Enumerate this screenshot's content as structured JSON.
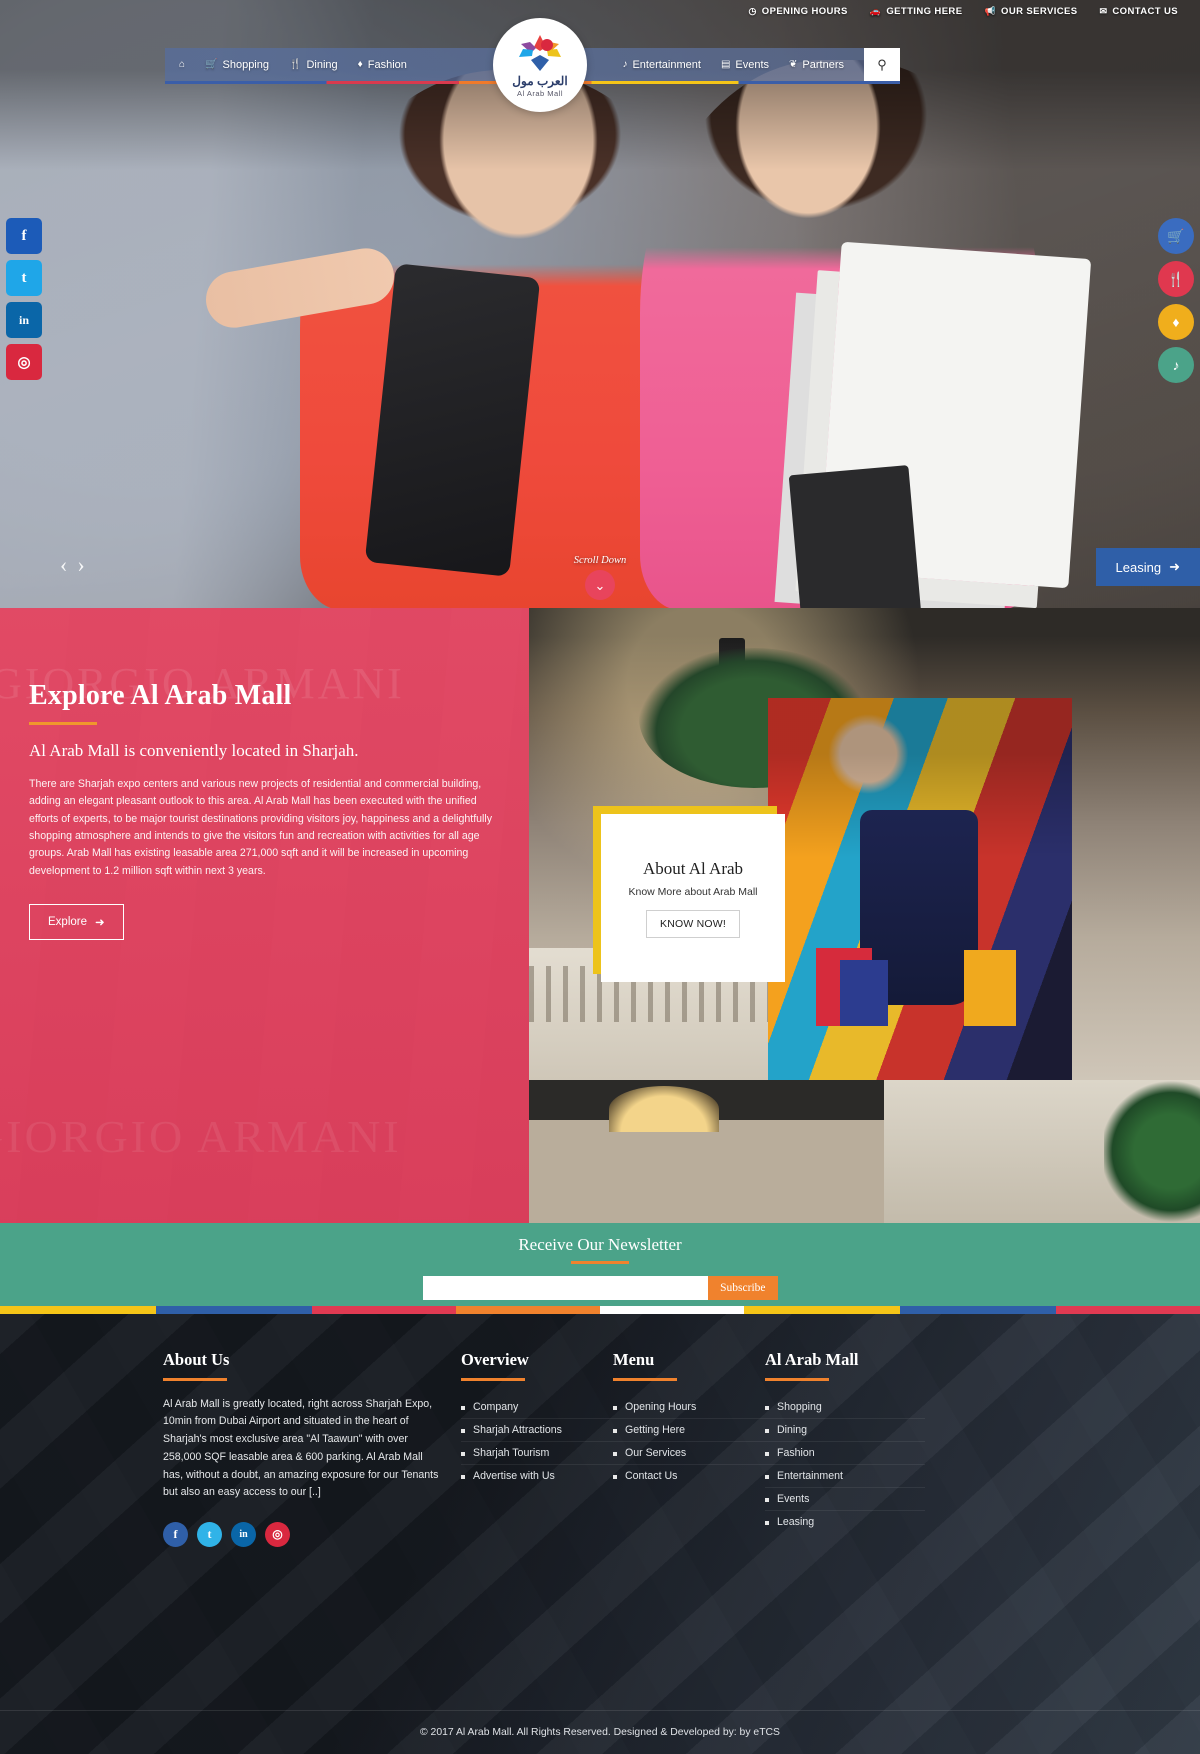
{
  "topbar": {
    "links": [
      {
        "icon": "clock-icon",
        "glyph": "◷",
        "label": "OPENING HOURS"
      },
      {
        "icon": "car-icon",
        "glyph": "⛟",
        "label": "GETTING HERE"
      },
      {
        "icon": "megaphone-icon",
        "glyph": "📣",
        "label": "OUR SERVICES"
      },
      {
        "icon": "envelope-icon",
        "glyph": "✉",
        "label": "CONTACT US"
      }
    ]
  },
  "nav": {
    "left": [
      {
        "icon": "home-icon",
        "glyph": "⌂",
        "label": ""
      },
      {
        "icon": "cart-icon",
        "glyph": "🛒",
        "label": "Shopping"
      },
      {
        "icon": "utensils-icon",
        "glyph": "🍴",
        "label": "Dining"
      },
      {
        "icon": "diamond-icon",
        "glyph": "♦",
        "label": "Fashion"
      }
    ],
    "right": [
      {
        "icon": "music-note-icon",
        "glyph": "♪",
        "label": "Entertainment"
      },
      {
        "icon": "list-icon",
        "glyph": "▤",
        "label": "Events"
      },
      {
        "icon": "handshake-icon",
        "glyph": "❦",
        "label": "Partners"
      }
    ],
    "search_icon": "search-icon",
    "search_glyph": "⌕"
  },
  "logo": {
    "arabic": "العرب مول",
    "english": "Al Arab Mall"
  },
  "hero": {
    "social_left": [
      {
        "name": "facebook",
        "glyph": "f",
        "color": "#1c5bb8"
      },
      {
        "name": "twitter",
        "glyph": "t",
        "color": "#1fa6e8"
      },
      {
        "name": "linkedin",
        "glyph": "in",
        "color": "#0a66a8"
      },
      {
        "name": "instagram",
        "glyph": "◎",
        "color": "#d9283f"
      }
    ],
    "quick_right": [
      {
        "name": "shopping",
        "glyph": "🛒",
        "color": "#3a6cc0"
      },
      {
        "name": "dining",
        "glyph": "🍴",
        "color": "#e0384f"
      },
      {
        "name": "fashion",
        "glyph": "♦",
        "color": "#f0ae1c"
      },
      {
        "name": "entertainment",
        "glyph": "♪",
        "color": "#4ba389"
      }
    ],
    "prev_glyph": "‹",
    "next_glyph": "›",
    "scroll_label": "Scroll Down",
    "scroll_glyph": "⌄⌄",
    "leasing_label": "Leasing",
    "leasing_arrow": "➜"
  },
  "explore": {
    "heading": "Explore Al Arab Mall",
    "subheading": "Al Arab Mall is conveniently located in Sharjah.",
    "paragraph": "There are Sharjah expo centers and various new projects of residential and commercial building, adding an elegant pleasant outlook to this area. Al Arab Mall has been executed with the unified efforts of experts, to be major tourist destinations providing visitors joy, happiness and a delightfully shopping atmosphere and intends to give the visitors fun and recreation with activities for all age groups. Arab Mall has existing leasable area 271,000 sqft and it will be increased in upcoming development to 1.2 million sqft within next 3 years.",
    "button_label": "Explore",
    "button_arrow": "➜"
  },
  "about_card": {
    "title": "About Al Arab",
    "subtitle": "Know More about Arab Mall",
    "button_label": "KNOW NOW!"
  },
  "newsletter": {
    "heading": "Receive Our Newsletter",
    "input_placeholder": "",
    "input_value": "",
    "button_label": "Subscribe"
  },
  "footer": {
    "about": {
      "heading": "About Us",
      "text": "Al Arab Mall is greatly located, right across Sharjah Expo, 10min from Dubai Airport and situated in the heart of Sharjah's most exclusive area \"Al Taawun\" with over 258,000 SQF leasable area & 600 parking. Al Arab Mall has, without a doubt, an amazing exposure for our Tenants but also an easy access to our [..]"
    },
    "social": [
      {
        "name": "facebook",
        "glyph": "f",
        "color": "#2f5fa8"
      },
      {
        "name": "twitter",
        "glyph": "t",
        "color": "#30b3e8"
      },
      {
        "name": "linkedin",
        "glyph": "in",
        "color": "#0a66a8"
      },
      {
        "name": "instagram",
        "glyph": "◎",
        "color": "#d9283f"
      }
    ],
    "overview": {
      "heading": "Overview",
      "items": [
        "Company",
        "Sharjah Attractions",
        "Sharjah Tourism",
        "Advertise with Us"
      ]
    },
    "menu": {
      "heading": "Menu",
      "items": [
        "Opening Hours",
        "Getting Here",
        "Our Services",
        "Contact Us"
      ]
    },
    "mall": {
      "heading": "Al Arab Mall",
      "items": [
        "Shopping",
        "Dining",
        "Fashion",
        "Entertainment",
        "Events",
        "Leasing"
      ]
    },
    "copyright": "© 2017 Al Arab Mall. All Rights Reserved. Designed & Developed by: by eTCS"
  },
  "colors": {
    "brand_red": "#de3654",
    "brand_blue": "#2f5fa8",
    "brand_orange": "#f0822d",
    "brand_green": "#4ba389",
    "brand_yellow": "#edc31b"
  }
}
